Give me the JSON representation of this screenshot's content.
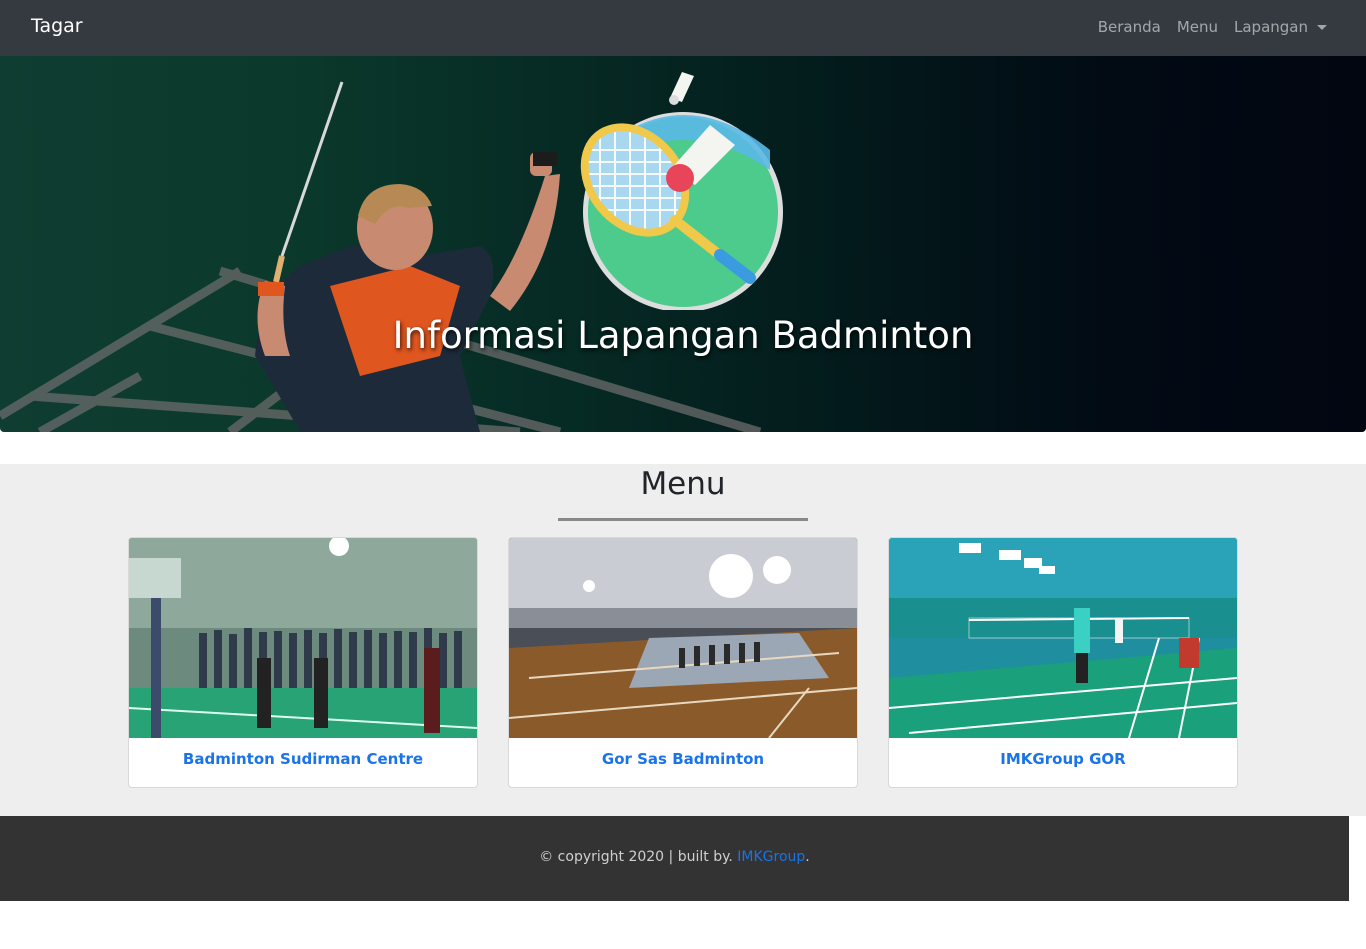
{
  "navbar": {
    "brand": "Tagar",
    "links": [
      "Beranda",
      "Menu",
      "Lapangan"
    ]
  },
  "hero": {
    "title": "Informasi Lapangan Badminton",
    "logo_icon": "badminton-racket-shuttlecock-icon"
  },
  "menu": {
    "heading": "Menu",
    "cards": [
      {
        "title": "Badminton Sudirman Centre"
      },
      {
        "title": "Gor Sas Badminton"
      },
      {
        "title": "IMKGroup GOR"
      }
    ]
  },
  "footer": {
    "text": "© copyright 2020 | built by.",
    "link": "IMKGroup",
    "period": "."
  },
  "colors": {
    "navbar_bg": "#343a40",
    "accent_link": "#1a73e8",
    "section_bg": "#eeeeee",
    "footer_bg": "#333333"
  }
}
